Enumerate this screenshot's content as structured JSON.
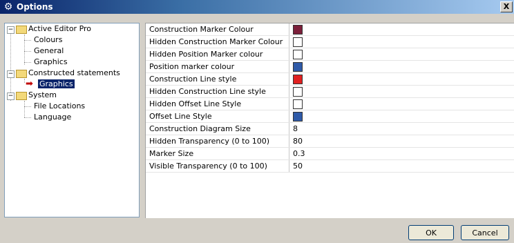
{
  "window": {
    "title": "Options",
    "close_glyph": "X"
  },
  "tree": {
    "nodes": [
      {
        "label": "Active Editor Pro",
        "expander": "−"
      },
      {
        "label": "Colours"
      },
      {
        "label": "General"
      },
      {
        "label": "Graphics"
      },
      {
        "label": "Constructed statements",
        "expander": "−"
      },
      {
        "label": "Graphics",
        "selected": true
      },
      {
        "label": "System",
        "expander": "−"
      },
      {
        "label": "File Locations"
      },
      {
        "label": "Language"
      }
    ]
  },
  "properties": [
    {
      "name": "Construction Marker Colour",
      "swatch": "#7b1f3a"
    },
    {
      "name": "Hidden Construction Marker Colour",
      "swatch": "#ffffff"
    },
    {
      "name": "Hidden Position Marker colour",
      "swatch": "#ffffff"
    },
    {
      "name": "Position marker colour",
      "swatch": "#2f5aa8"
    },
    {
      "name": "Construction Line style",
      "swatch": "#e02020"
    },
    {
      "name": "Hidden Construction Line style",
      "swatch": "#ffffff"
    },
    {
      "name": "Hidden Offset Line Style",
      "swatch": "#ffffff"
    },
    {
      "name": "Offset Line Style",
      "swatch": "#2f5aa8"
    },
    {
      "name": "Construction Diagram Size",
      "value": "8"
    },
    {
      "name": "Hidden Transparency (0 to 100)",
      "value": "80"
    },
    {
      "name": "Marker Size",
      "value": "0.3"
    },
    {
      "name": "Visible Transparency (0 to 100)",
      "value": "50"
    }
  ],
  "buttons": {
    "ok": "OK",
    "cancel": "Cancel"
  }
}
